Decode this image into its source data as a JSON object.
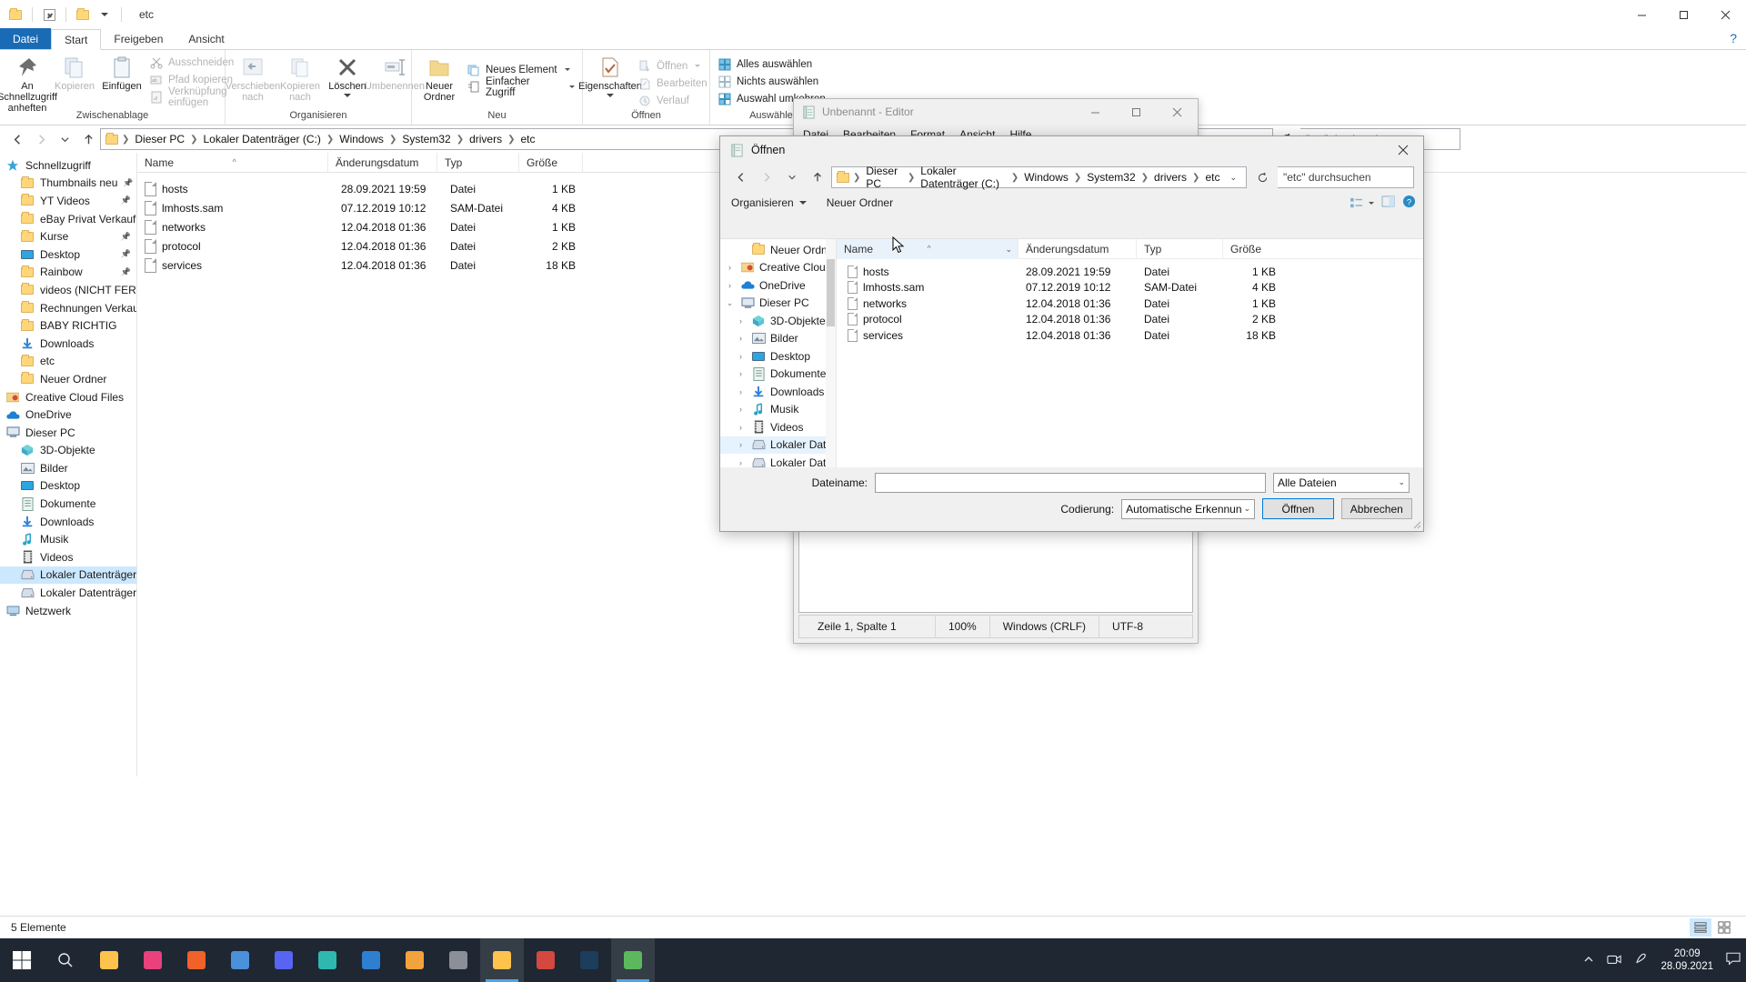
{
  "explorer": {
    "window_title": "etc",
    "quick_access_icons": [
      "folder-icon",
      "properties-icon",
      "new-folder-icon",
      "dropdown-caret-icon"
    ],
    "window_buttons": {
      "minimize": "–",
      "maximize": "☐",
      "close": "✕"
    },
    "tabs": [
      {
        "label": "Datei",
        "active": false,
        "file_menu": true
      },
      {
        "label": "Start",
        "active": true
      },
      {
        "label": "Freigeben",
        "active": false
      },
      {
        "label": "Ansicht",
        "active": false
      }
    ],
    "help_label": "?",
    "ribbon": {
      "groups": [
        {
          "name": "Zwischenablage",
          "big": [
            {
              "label_line1": "An Schnellzugriff",
              "label_line2": "anheften",
              "icon": "pin-icon",
              "disabled": false
            },
            {
              "label_line1": "Kopieren",
              "label_line2": "",
              "icon": "copy-icon",
              "disabled": true
            },
            {
              "label_line1": "Einfügen",
              "label_line2": "",
              "icon": "paste-icon",
              "disabled": false
            }
          ],
          "small": [
            {
              "label": "Ausschneiden",
              "icon": "scissors-icon",
              "disabled": true
            },
            {
              "label": "Pfad kopieren",
              "icon": "copy-path-icon",
              "disabled": true
            },
            {
              "label": "Verknüpfung einfügen",
              "icon": "paste-shortcut-icon",
              "disabled": true
            }
          ]
        },
        {
          "name": "Organisieren",
          "big": [
            {
              "label_line1": "Verschieben",
              "label_line2": "nach",
              "icon": "move-to-icon",
              "disabled": true,
              "caret": true
            },
            {
              "label_line1": "Kopieren",
              "label_line2": "nach",
              "icon": "copy-to-icon",
              "disabled": true,
              "caret": true
            },
            {
              "label_line1": "Löschen",
              "label_line2": "",
              "icon": "delete-x-icon",
              "disabled": false,
              "caret": true
            },
            {
              "label_line1": "Umbenennen",
              "label_line2": "",
              "icon": "rename-icon",
              "disabled": true
            }
          ],
          "small": []
        },
        {
          "name": "Neu",
          "big": [
            {
              "label_line1": "Neuer",
              "label_line2": "Ordner",
              "icon": "new-folder-icon",
              "disabled": false
            }
          ],
          "small": [
            {
              "label": "Neues Element",
              "icon": "new-item-icon",
              "disabled": false,
              "caret": true
            },
            {
              "label": "Einfacher Zugriff",
              "icon": "easy-access-icon",
              "disabled": false,
              "caret": true
            }
          ]
        },
        {
          "name": "Öffnen",
          "big": [
            {
              "label_line1": "Eigenschaften",
              "label_line2": "",
              "icon": "properties-icon",
              "disabled": false,
              "caret": true
            }
          ],
          "small": [
            {
              "label": "Öffnen",
              "icon": "open-icon",
              "disabled": true,
              "caret": true
            },
            {
              "label": "Bearbeiten",
              "icon": "edit-icon",
              "disabled": true
            },
            {
              "label": "Verlauf",
              "icon": "history-icon",
              "disabled": true
            }
          ]
        },
        {
          "name": "Auswählen",
          "big": [],
          "small": [
            {
              "label": "Alles auswählen",
              "icon": "select-all-icon",
              "disabled": false
            },
            {
              "label": "Nichts auswählen",
              "icon": "select-none-icon",
              "disabled": false
            },
            {
              "label": "Auswahl umkehren",
              "icon": "invert-selection-icon",
              "disabled": false
            }
          ]
        }
      ]
    },
    "address": {
      "back_icon": "arrow-left-icon",
      "forward_icon": "arrow-right-icon",
      "recent_icon": "chevron-down-icon",
      "up_icon": "arrow-up-icon",
      "crumbs": [
        "Dieser PC",
        "Lokaler Datenträger (C:)",
        "Windows",
        "System32",
        "drivers",
        "etc"
      ],
      "refresh_icon": "refresh-icon",
      "search_placeholder": "\"etc\" durchsuchen"
    },
    "nav_pane": [
      {
        "label": "Schnellzugriff",
        "icon": "star-icon",
        "level": 0,
        "pinned": false
      },
      {
        "label": "Thumbnails neu",
        "icon": "folder-icon",
        "level": 1,
        "pinned": true
      },
      {
        "label": "YT Videos",
        "icon": "folder-icon",
        "level": 1,
        "pinned": true
      },
      {
        "label": "eBay Privat Verkauf",
        "icon": "folder-icon",
        "level": 1,
        "pinned": true
      },
      {
        "label": "Kurse",
        "icon": "folder-icon",
        "level": 1,
        "pinned": true
      },
      {
        "label": "Desktop",
        "icon": "desktop-icon",
        "level": 1,
        "pinned": true
      },
      {
        "label": "Rainbow",
        "icon": "folder-icon",
        "level": 1,
        "pinned": true
      },
      {
        "label": "videos (NICHT FERT",
        "icon": "folder-icon",
        "level": 1,
        "pinned": true
      },
      {
        "label": "Rechnungen Verkau",
        "icon": "folder-icon",
        "level": 1,
        "pinned": true
      },
      {
        "label": "BABY RICHTIG",
        "icon": "folder-icon",
        "level": 1,
        "pinned": false
      },
      {
        "label": "Downloads",
        "icon": "download-icon",
        "level": 1,
        "pinned": false
      },
      {
        "label": "etc",
        "icon": "folder-icon",
        "level": 1,
        "pinned": false
      },
      {
        "label": "Neuer Ordner",
        "icon": "folder-icon",
        "level": 1,
        "pinned": false
      },
      {
        "label": "Creative Cloud Files",
        "icon": "creative-cloud-icon",
        "level": 0,
        "pinned": false
      },
      {
        "label": "OneDrive",
        "icon": "cloud-icon",
        "level": 0,
        "pinned": false
      },
      {
        "label": "Dieser PC",
        "icon": "pc-icon",
        "level": 0,
        "pinned": false
      },
      {
        "label": "3D-Objekte",
        "icon": "3d-objects-icon",
        "level": 1,
        "pinned": false
      },
      {
        "label": "Bilder",
        "icon": "pictures-icon",
        "level": 1,
        "pinned": false
      },
      {
        "label": "Desktop",
        "icon": "desktop-icon",
        "level": 1,
        "pinned": false
      },
      {
        "label": "Dokumente",
        "icon": "documents-icon",
        "level": 1,
        "pinned": false
      },
      {
        "label": "Downloads",
        "icon": "download-icon",
        "level": 1,
        "pinned": false
      },
      {
        "label": "Musik",
        "icon": "music-icon",
        "level": 1,
        "pinned": false
      },
      {
        "label": "Videos",
        "icon": "videos-icon",
        "level": 1,
        "pinned": false
      },
      {
        "label": "Lokaler Datenträger (C",
        "icon": "drive-icon",
        "level": 1,
        "pinned": false,
        "selected": true
      },
      {
        "label": "Lokaler Datenträger (D",
        "icon": "drive-icon",
        "level": 1,
        "pinned": false
      },
      {
        "label": "Netzwerk",
        "icon": "network-icon",
        "level": 0,
        "pinned": false
      }
    ],
    "columns": [
      {
        "label": "Name",
        "sorted": true
      },
      {
        "label": "Änderungsdatum",
        "sorted": false
      },
      {
        "label": "Typ",
        "sorted": false
      },
      {
        "label": "Größe",
        "sorted": false
      }
    ],
    "files": [
      {
        "name": "hosts",
        "date": "28.09.2021 19:59",
        "type": "Datei",
        "size": "1 KB"
      },
      {
        "name": "lmhosts.sam",
        "date": "07.12.2019 10:12",
        "type": "SAM-Datei",
        "size": "4 KB"
      },
      {
        "name": "networks",
        "date": "12.04.2018 01:36",
        "type": "Datei",
        "size": "1 KB"
      },
      {
        "name": "protocol",
        "date": "12.04.2018 01:36",
        "type": "Datei",
        "size": "2 KB"
      },
      {
        "name": "services",
        "date": "12.04.2018 01:36",
        "type": "Datei",
        "size": "18 KB"
      }
    ],
    "status": {
      "count_label": "5 Elemente",
      "view_details_icon": "details-view-icon",
      "view_large_icon": "large-icons-view-icon"
    }
  },
  "notepad": {
    "title": "Unbenannt - Editor",
    "icon": "notepad-icon",
    "window_buttons": {
      "minimize": "–",
      "maximize": "☐",
      "close": "✕"
    },
    "menu": [
      "Datei",
      "Bearbeiten",
      "Format",
      "Ansicht",
      "Hilfe"
    ],
    "text": "",
    "status": {
      "position": "Zeile 1, Spalte 1",
      "zoom": "100%",
      "line_ending": "Windows (CRLF)",
      "encoding": "UTF-8"
    }
  },
  "open_dialog": {
    "title": "Öffnen",
    "icon": "notepad-icon",
    "close_label": "✕",
    "address": {
      "crumbs": [
        "Dieser PC",
        "Lokaler Datenträger (C:)",
        "Windows",
        "System32",
        "drivers",
        "etc"
      ],
      "search_placeholder": "\"etc\" durchsuchen"
    },
    "toolbar": {
      "organize": "Organisieren",
      "new_folder": "Neuer Ordner",
      "view_icon": "view-options-icon",
      "preview_icon": "preview-pane-icon",
      "help_icon": "help-icon"
    },
    "nav_pane": [
      {
        "label": "Neuer Ordner",
        "icon": "folder-icon",
        "level": 1,
        "arrow": ""
      },
      {
        "label": "Creative Cloud Fil",
        "icon": "creative-cloud-icon",
        "level": 0,
        "arrow": "›"
      },
      {
        "label": "OneDrive",
        "icon": "cloud-icon",
        "level": 0,
        "arrow": "›"
      },
      {
        "label": "Dieser PC",
        "icon": "pc-icon",
        "level": 0,
        "arrow": "⌄"
      },
      {
        "label": "3D-Objekte",
        "icon": "3d-objects-icon",
        "level": 1,
        "arrow": "›"
      },
      {
        "label": "Bilder",
        "icon": "pictures-icon",
        "level": 1,
        "arrow": "›"
      },
      {
        "label": "Desktop",
        "icon": "desktop-icon",
        "level": 1,
        "arrow": "›"
      },
      {
        "label": "Dokumente",
        "icon": "documents-icon",
        "level": 1,
        "arrow": "›"
      },
      {
        "label": "Downloads",
        "icon": "download-icon",
        "level": 1,
        "arrow": "›"
      },
      {
        "label": "Musik",
        "icon": "music-icon",
        "level": 1,
        "arrow": "›"
      },
      {
        "label": "Videos",
        "icon": "videos-icon",
        "level": 1,
        "arrow": "›"
      },
      {
        "label": "Lokaler Datenträ",
        "icon": "drive-icon",
        "level": 1,
        "arrow": "›",
        "selected": true
      },
      {
        "label": "Lokaler Datenträ",
        "icon": "drive-icon",
        "level": 1,
        "arrow": "›"
      }
    ],
    "columns": [
      {
        "label": "Name",
        "sorted": true
      },
      {
        "label": "Änderungsdatum",
        "sorted": false
      },
      {
        "label": "Typ",
        "sorted": false
      },
      {
        "label": "Größe",
        "sorted": false
      }
    ],
    "files": [
      {
        "name": "hosts",
        "date": "28.09.2021 19:59",
        "type": "Datei",
        "size": "1 KB"
      },
      {
        "name": "lmhosts.sam",
        "date": "07.12.2019 10:12",
        "type": "SAM-Datei",
        "size": "4 KB"
      },
      {
        "name": "networks",
        "date": "12.04.2018 01:36",
        "type": "Datei",
        "size": "1 KB"
      },
      {
        "name": "protocol",
        "date": "12.04.2018 01:36",
        "type": "Datei",
        "size": "2 KB"
      },
      {
        "name": "services",
        "date": "12.04.2018 01:36",
        "type": "Datei",
        "size": "18 KB"
      }
    ],
    "filename_label": "Dateiname:",
    "filename_value": "",
    "filetype_value": "Alle Dateien",
    "encoding_label": "Codierung:",
    "encoding_value": "Automatische Erkennun",
    "open_button": "Öffnen",
    "cancel_button": "Abbrechen"
  },
  "taskbar": {
    "start_icon": "windows-start-icon",
    "search_icon": "search-icon",
    "apps": [
      {
        "name": "file-explorer-icon",
        "color": "#ffc34d",
        "active": false
      },
      {
        "name": "app-pink-icon",
        "color": "#e8417c",
        "active": false
      },
      {
        "name": "firefox-icon",
        "color": "#f0622a",
        "active": false
      },
      {
        "name": "chrome-icon",
        "color": "#4a90d9",
        "active": false
      },
      {
        "name": "discord-icon",
        "color": "#5865f2",
        "active": false
      },
      {
        "name": "app-teal-icon",
        "color": "#2fb8b0",
        "active": false
      },
      {
        "name": "app-blue-icon",
        "color": "#2f7fd1",
        "active": false
      },
      {
        "name": "app-orange-icon",
        "color": "#f2a33c",
        "active": false
      },
      {
        "name": "app-gray-icon",
        "color": "#8a8f98",
        "active": false
      },
      {
        "name": "explorer-active-icon",
        "color": "#ffc34d",
        "active": true
      },
      {
        "name": "app-red-icon",
        "color": "#d4483f",
        "active": false
      },
      {
        "name": "photoshop-icon",
        "color": "#1c3d5c",
        "active": false
      },
      {
        "name": "notepad-active-icon",
        "color": "#5cb85c",
        "active": true
      }
    ],
    "tray": {
      "chevron_icon": "show-hidden-icons-icon",
      "camera_icon": "camera-icon",
      "pen_icon": "pen-icon",
      "time": "20:09",
      "date": "28.09.2021",
      "notification_icon": "notifications-icon"
    }
  }
}
